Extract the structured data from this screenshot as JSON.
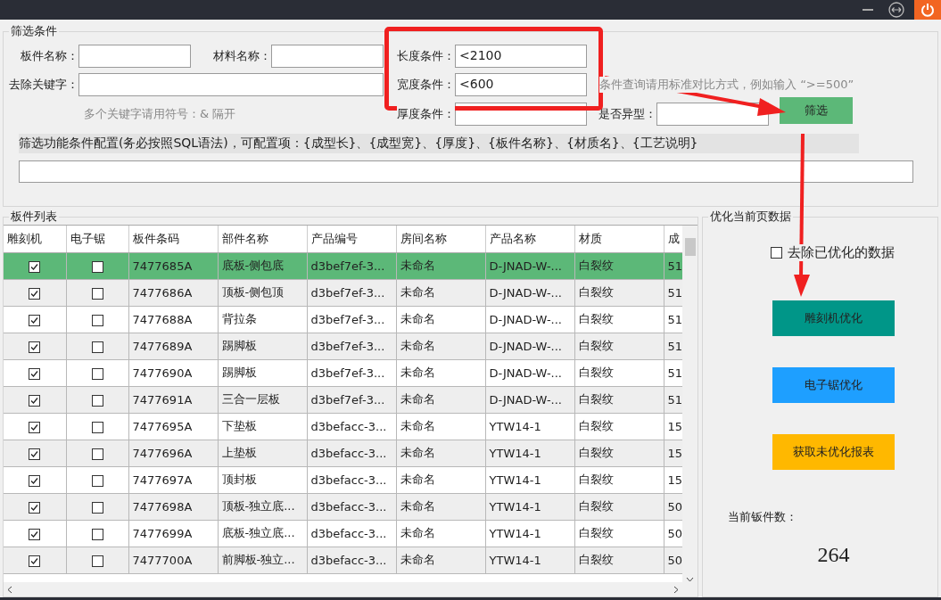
{
  "filter": {
    "title": "筛选条件",
    "board_name": {
      "label": "板件名称："
    },
    "material_name": {
      "label": "材料名称："
    },
    "length": {
      "label": "长度条件：",
      "value": "<2100"
    },
    "exclude_keywords": {
      "label": "去除关键字："
    },
    "width": {
      "label": "宽度条件：",
      "value": "<600"
    },
    "compare_hint": "条件查询请用标准对比方式，例如输入 “>=500”",
    "keywords_hint": "多个关键字请用符号：& 隔开",
    "thickness": {
      "label": "厚度条件："
    },
    "irregular": {
      "label": "是否异型："
    },
    "filter_button": "筛选",
    "config_label": "筛选功能条件配置(务必按照SQL语法)，可配置项：{成型长}、{成型宽}、{厚度}、{板件名称}、{材质名}、{工艺说明}"
  },
  "table": {
    "title": "板件列表",
    "columns": [
      "雕刻机",
      "电子锯",
      "板件条码",
      "部件名称",
      "产品编号",
      "房间名称",
      "产品名称",
      "材质",
      "成"
    ],
    "rows": [
      {
        "selected": true,
        "cells": [
          {
            "checked": true
          },
          {
            "checked": false
          },
          "7477685A",
          "底板-侧包底",
          "d3bef7ef-3...",
          "未命名",
          "D-JNAD-W-...",
          "白裂纹",
          "51"
        ]
      },
      {
        "selected": false,
        "cells": [
          {
            "checked": true
          },
          {
            "checked": false
          },
          "7477686A",
          "顶板-侧包顶",
          "d3bef7ef-3...",
          "未命名",
          "D-JNAD-W-...",
          "白裂纹",
          "51"
        ]
      },
      {
        "selected": false,
        "cells": [
          {
            "checked": true
          },
          {
            "checked": false
          },
          "7477688A",
          "背拉条",
          "d3bef7ef-3...",
          "未命名",
          "D-JNAD-W-...",
          "白裂纹",
          "51"
        ]
      },
      {
        "selected": false,
        "cells": [
          {
            "checked": true
          },
          {
            "checked": false
          },
          "7477689A",
          "踢脚板",
          "d3bef7ef-3...",
          "未命名",
          "D-JNAD-W-...",
          "白裂纹",
          "51"
        ]
      },
      {
        "selected": false,
        "cells": [
          {
            "checked": true
          },
          {
            "checked": false
          },
          "7477690A",
          "踢脚板",
          "d3bef7ef-3...",
          "未命名",
          "D-JNAD-W-...",
          "白裂纹",
          "51"
        ]
      },
      {
        "selected": false,
        "cells": [
          {
            "checked": true
          },
          {
            "checked": false
          },
          "7477691A",
          "三合一层板",
          "d3bef7ef-3...",
          "未命名",
          "D-JNAD-W-...",
          "白裂纹",
          "51"
        ]
      },
      {
        "selected": false,
        "cells": [
          {
            "checked": true
          },
          {
            "checked": false
          },
          "7477695A",
          "下垫板",
          "d3befacc-3...",
          "未命名",
          "YTW14-1",
          "白裂纹",
          "15"
        ]
      },
      {
        "selected": false,
        "cells": [
          {
            "checked": true
          },
          {
            "checked": false
          },
          "7477696A",
          "上垫板",
          "d3befacc-3...",
          "未命名",
          "YTW14-1",
          "白裂纹",
          "15"
        ]
      },
      {
        "selected": false,
        "cells": [
          {
            "checked": true
          },
          {
            "checked": false
          },
          "7477697A",
          "顶封板",
          "d3befacc-3...",
          "未命名",
          "YTW14-1",
          "白裂纹",
          "15"
        ]
      },
      {
        "selected": false,
        "cells": [
          {
            "checked": true
          },
          {
            "checked": false
          },
          "7477698A",
          "顶板-独立底...",
          "d3befacc-3...",
          "未命名",
          "YTW14-1",
          "白裂纹",
          "50"
        ]
      },
      {
        "selected": false,
        "cells": [
          {
            "checked": true
          },
          {
            "checked": false
          },
          "7477699A",
          "底板-独立底...",
          "d3befacc-3...",
          "未命名",
          "YTW14-1",
          "白裂纹",
          "50"
        ]
      },
      {
        "selected": false,
        "cells": [
          {
            "checked": true
          },
          {
            "checked": false
          },
          "7477700A",
          "前脚板-独立...",
          "d3befacc-3...",
          "未命名",
          "YTW14-1",
          "白裂纹",
          "50"
        ]
      }
    ]
  },
  "panel": {
    "title": "优化当前页数据",
    "exclude_optimized": {
      "label": "去除已优化的数据",
      "checked": false
    },
    "buttons": [
      {
        "label": "雕刻机优化",
        "color": "#009688"
      },
      {
        "label": "电子锯优化",
        "color": "#1e9fff"
      },
      {
        "label": "获取未优化报表",
        "color": "#ffb800"
      }
    ],
    "count_label": "当前钣件数：",
    "count": "264"
  },
  "annotations": [
    {
      "kind": "box"
    },
    {
      "kind": "arrow"
    },
    {
      "kind": "arrow"
    }
  ]
}
